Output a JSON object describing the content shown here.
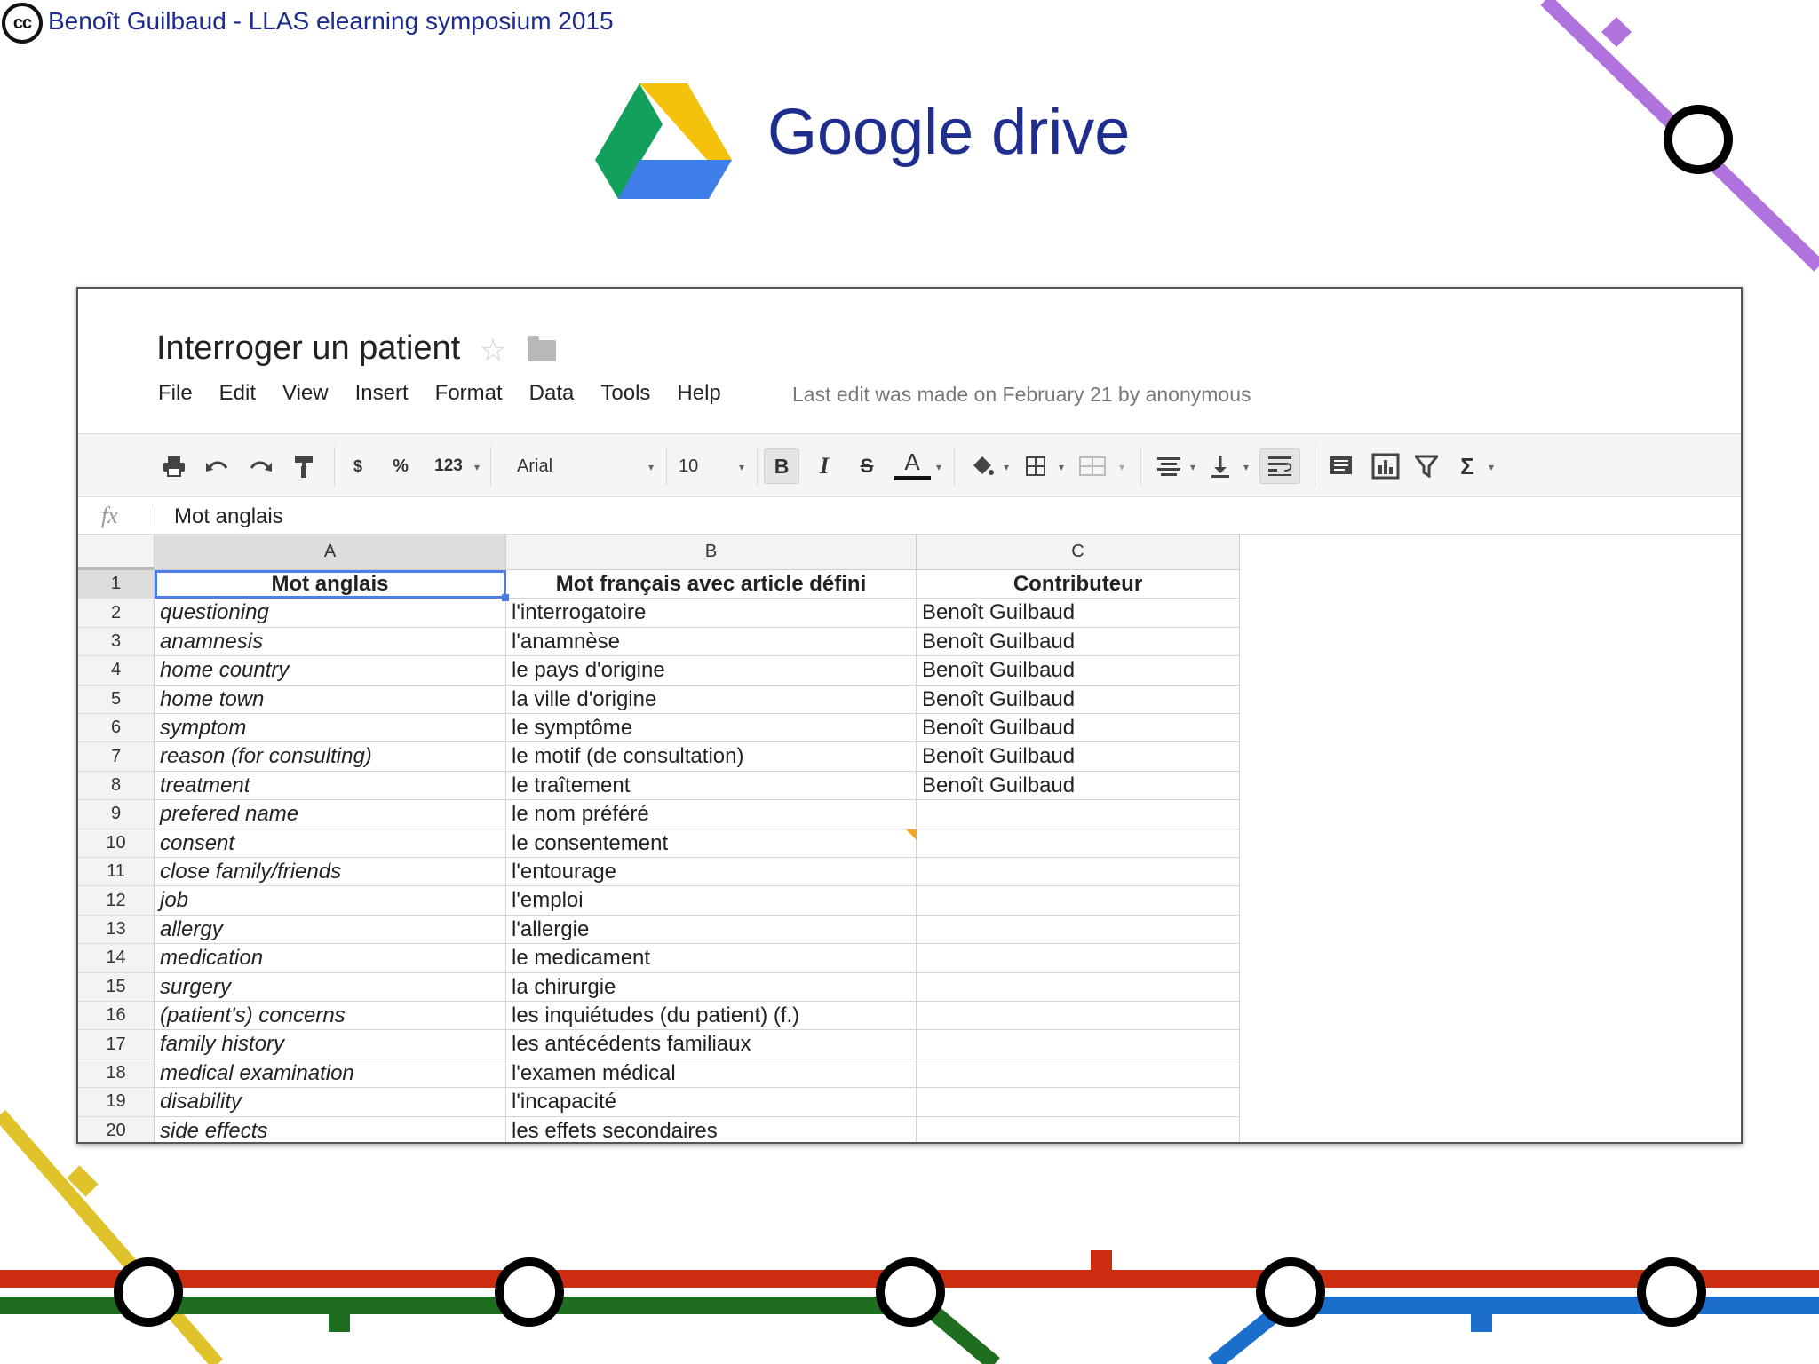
{
  "slide": {
    "credit": "Benoît Guilbaud - LLAS elearning symposium 2015",
    "cc_label": "cc",
    "title": "Google drive",
    "metro_colors": {
      "red": "#cc2d10",
      "green": "#1f6e20",
      "blue": "#1a6fcc",
      "yellow": "#e0c22a",
      "purple": "#b072dd"
    }
  },
  "spreadsheet": {
    "title": "Interroger un patient",
    "menu": [
      "File",
      "Edit",
      "View",
      "Insert",
      "Format",
      "Data",
      "Tools",
      "Help"
    ],
    "last_edit": "Last edit was made on February 21 by anonymous",
    "toolbar": {
      "currency": "$",
      "percent": "%",
      "number_format": "123",
      "font": "Arial",
      "font_size": "10",
      "bold": "B",
      "italic": "I",
      "strikethrough": "S",
      "text_color": "A",
      "sum": "Σ"
    },
    "formula_bar": {
      "fx_label": "fx",
      "value": "Mot anglais"
    },
    "columns": [
      "A",
      "B",
      "C"
    ],
    "header": {
      "a": "Mot anglais",
      "b": "Mot français avec article défini",
      "c": "Contributeur"
    },
    "rows": [
      {
        "num": "2",
        "a": "questioning",
        "b": "l'interrogatoire",
        "c": "Benoît Guilbaud"
      },
      {
        "num": "3",
        "a": "anamnesis",
        "b": "l'anamnèse",
        "c": "Benoît Guilbaud"
      },
      {
        "num": "4",
        "a": "home country",
        "b": "le pays d'origine",
        "c": "Benoît Guilbaud"
      },
      {
        "num": "5",
        "a": "home town",
        "b": "la ville d'origine",
        "c": "Benoît Guilbaud"
      },
      {
        "num": "6",
        "a": "symptom",
        "b": "le symptôme",
        "c": "Benoît Guilbaud"
      },
      {
        "num": "7",
        "a": "reason (for consulting)",
        "b": "le motif (de consultation)",
        "c": "Benoît Guilbaud"
      },
      {
        "num": "8",
        "a": "treatment",
        "b": "le traîtement",
        "c": "Benoît Guilbaud"
      },
      {
        "num": "9",
        "a": "prefered name",
        "b": "le nom préféré",
        "c": ""
      },
      {
        "num": "10",
        "a": "consent",
        "b": "le consentement",
        "c": ""
      },
      {
        "num": "11",
        "a": "close family/friends",
        "b": "l'entourage",
        "c": ""
      },
      {
        "num": "12",
        "a": "job",
        "b": "l'emploi",
        "c": ""
      },
      {
        "num": "13",
        "a": "allergy",
        "b": "l'allergie",
        "c": ""
      },
      {
        "num": "14",
        "a": "medication",
        "b": "le medicament",
        "c": ""
      },
      {
        "num": "15",
        "a": "surgery",
        "b": "la chirurgie",
        "c": ""
      },
      {
        "num": "16",
        "a": "(patient's) concerns",
        "b": "les inquiétudes (du patient) (f.)",
        "c": ""
      },
      {
        "num": "17",
        "a": "family history",
        "b": "les antécédents familiaux",
        "c": ""
      },
      {
        "num": "18",
        "a": "medical examination",
        "b": "l'examen médical",
        "c": ""
      },
      {
        "num": "19",
        "a": "disability",
        "b": "l'incapacité",
        "c": ""
      },
      {
        "num": "20",
        "a": "side effects",
        "b": "les effets secondaires",
        "c": ""
      }
    ]
  }
}
